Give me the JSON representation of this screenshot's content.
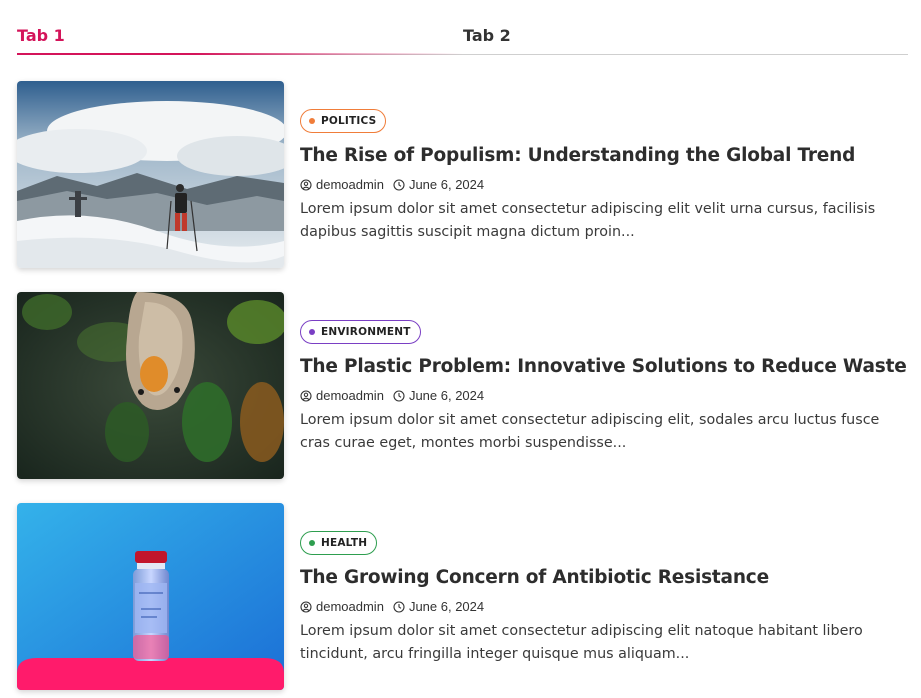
{
  "tabs": [
    {
      "label": "Tab 1",
      "active": true
    },
    {
      "label": "Tab 2",
      "active": false
    }
  ],
  "accent_color": "#d4145a",
  "posts": [
    {
      "category": "POLITICS",
      "category_color": "#f07d3a",
      "title": "The Rise of Populism: Understanding the Global Trend",
      "author": "demoadmin",
      "date": "June 6, 2024",
      "excerpt": "Lorem ipsum dolor sit amet consectetur adipiscing elit velit urna cursus, facilisis dapibus sagittis suscipit magna dictum proin...",
      "image_icon": "mountain-hiker-image"
    },
    {
      "category": "ENVIRONMENT",
      "category_color": "#7a3fc4",
      "title": "The Plastic Problem: Innovative Solutions to Reduce Waste",
      "author": "demoadmin",
      "date": "June 6, 2024",
      "excerpt": "Lorem ipsum dolor sit amet consectetur adipiscing elit, sodales arcu luctus fusce cras curae eget, montes morbi suspendisse...",
      "image_icon": "mouse-eating-image"
    },
    {
      "category": "HEALTH",
      "category_color": "#2e9e4f",
      "title": "The Growing Concern of Antibiotic Resistance",
      "author": "demoadmin",
      "date": "June 6, 2024",
      "excerpt": "Lorem ipsum dolor sit amet consectetur adipiscing elit natoque habitant libero tincidunt, arcu fringilla integer quisque mus aliquam...",
      "image_icon": "vaccine-vial-image"
    }
  ],
  "icons": {
    "author": "user-circle-icon",
    "date": "clock-icon"
  }
}
